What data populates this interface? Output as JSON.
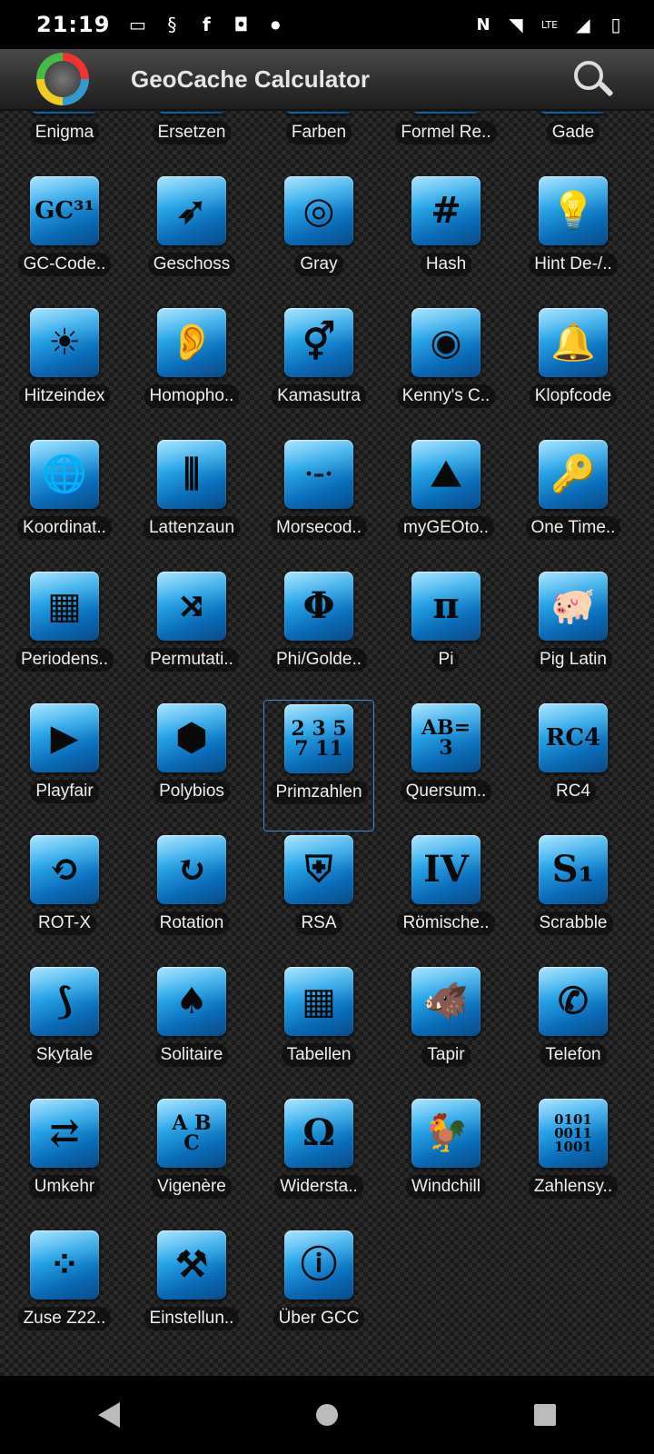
{
  "status": {
    "time": "21:19",
    "left_icons": [
      "laptop-icon",
      "s-icon",
      "facebook-icon",
      "instagram-icon",
      "dot-icon"
    ],
    "right_icons": [
      "nfc-icon",
      "wifi-icon",
      "lte-icon",
      "signal-icon",
      "battery-icon"
    ],
    "lte": "LTE"
  },
  "toolbar": {
    "title": "GeoCache Calculator"
  },
  "apps": [
    {
      "label": "Enigma",
      "glyph": "",
      "icon": "enigma-icon"
    },
    {
      "label": "Ersetzen",
      "glyph": "",
      "icon": "replace-icon"
    },
    {
      "label": "Farben",
      "glyph": "",
      "icon": "colors-icon"
    },
    {
      "label": "Formel Re..",
      "glyph": "",
      "icon": "formula-icon"
    },
    {
      "label": "Gade",
      "glyph": "",
      "icon": "gade-icon"
    },
    {
      "label": "GC-Code..",
      "glyph": "GC³¹",
      "icon": "gc-code-icon"
    },
    {
      "label": "Geschoss",
      "glyph": "➶",
      "icon": "bullet-icon"
    },
    {
      "label": "Gray",
      "glyph": "◎",
      "icon": "gray-code-icon"
    },
    {
      "label": "Hash",
      "glyph": "#",
      "icon": "hash-icon"
    },
    {
      "label": "Hint De-/..",
      "glyph": "💡",
      "icon": "lightbulb-icon"
    },
    {
      "label": "Hitzeindex",
      "glyph": "☀",
      "icon": "sun-icon"
    },
    {
      "label": "Homopho..",
      "glyph": "👂",
      "icon": "ear-icon"
    },
    {
      "label": "Kamasutra",
      "glyph": "⚥",
      "icon": "gender-icon"
    },
    {
      "label": "Kenny's C..",
      "glyph": "◉",
      "icon": "kenny-icon"
    },
    {
      "label": "Klopfcode",
      "glyph": "🔔",
      "icon": "knock-icon"
    },
    {
      "label": "Koordinat..",
      "glyph": "🌐",
      "icon": "globe-icon"
    },
    {
      "label": "Lattenzaun",
      "glyph": "⫼",
      "icon": "fence-icon"
    },
    {
      "label": "Morsecod..",
      "glyph": "·–·",
      "icon": "morse-icon"
    },
    {
      "label": "myGEOto..",
      "glyph": "⛰",
      "icon": "landscape-icon"
    },
    {
      "label": "One Time..",
      "glyph": "🔑",
      "icon": "key-icon"
    },
    {
      "label": "Periodens..",
      "glyph": "▦",
      "icon": "periodic-table-icon"
    },
    {
      "label": "Permutati..",
      "glyph": "⤨",
      "icon": "permutation-icon"
    },
    {
      "label": "Phi/Golde..",
      "glyph": "Φ",
      "icon": "phi-icon"
    },
    {
      "label": "Pi",
      "glyph": "π",
      "icon": "pi-icon"
    },
    {
      "label": "Pig Latin",
      "glyph": "🐖",
      "icon": "pig-icon"
    },
    {
      "label": "Playfair",
      "glyph": "▶",
      "icon": "play-icon"
    },
    {
      "label": "Polybios",
      "glyph": "⬢",
      "icon": "honeycomb-icon"
    },
    {
      "label": "Primzahlen",
      "glyph": "2 3 5\n7 11",
      "icon": "primes-icon"
    },
    {
      "label": "Quersum..",
      "glyph": "AB=\n3",
      "icon": "cross-sum-icon"
    },
    {
      "label": "RC4",
      "glyph": "RC4",
      "icon": "rc4-icon"
    },
    {
      "label": "ROT-X",
      "glyph": "⟲",
      "icon": "rotate-x-icon"
    },
    {
      "label": "Rotation",
      "glyph": "↻",
      "icon": "rotation-icon"
    },
    {
      "label": "RSA",
      "glyph": "⛨",
      "icon": "police-badge-icon"
    },
    {
      "label": "Römische..",
      "glyph": "IV",
      "icon": "roman-numeral-icon"
    },
    {
      "label": "Scrabble",
      "glyph": "S₁",
      "icon": "scrabble-icon"
    },
    {
      "label": "Skytale",
      "glyph": "⟆",
      "icon": "scytale-icon"
    },
    {
      "label": "Solitaire",
      "glyph": "♠",
      "icon": "cards-icon"
    },
    {
      "label": "Tabellen",
      "glyph": "▦",
      "icon": "table-icon"
    },
    {
      "label": "Tapir",
      "glyph": "🐗",
      "icon": "tapir-icon"
    },
    {
      "label": "Telefon",
      "glyph": "✆",
      "icon": "phone-icon"
    },
    {
      "label": "Umkehr",
      "glyph": "⇄",
      "icon": "reverse-icon"
    },
    {
      "label": "Vigenère",
      "glyph": "A B\nC",
      "icon": "vigenere-icon"
    },
    {
      "label": "Widersta..",
      "glyph": "Ω",
      "icon": "omega-icon"
    },
    {
      "label": "Windchill",
      "glyph": "🐓",
      "icon": "weathervane-icon"
    },
    {
      "label": "Zahlensy..",
      "glyph": "0101\n0011\n1001",
      "icon": "binary-icon"
    },
    {
      "label": "Zuse Z22..",
      "glyph": "⁘",
      "icon": "punchcard-icon"
    },
    {
      "label": "Einstellun..",
      "glyph": "⚒",
      "icon": "settings-tools-icon"
    },
    {
      "label": "Über GCC",
      "glyph": "ⓘ",
      "icon": "info-icon"
    }
  ],
  "selected_app": "Primzahlen"
}
